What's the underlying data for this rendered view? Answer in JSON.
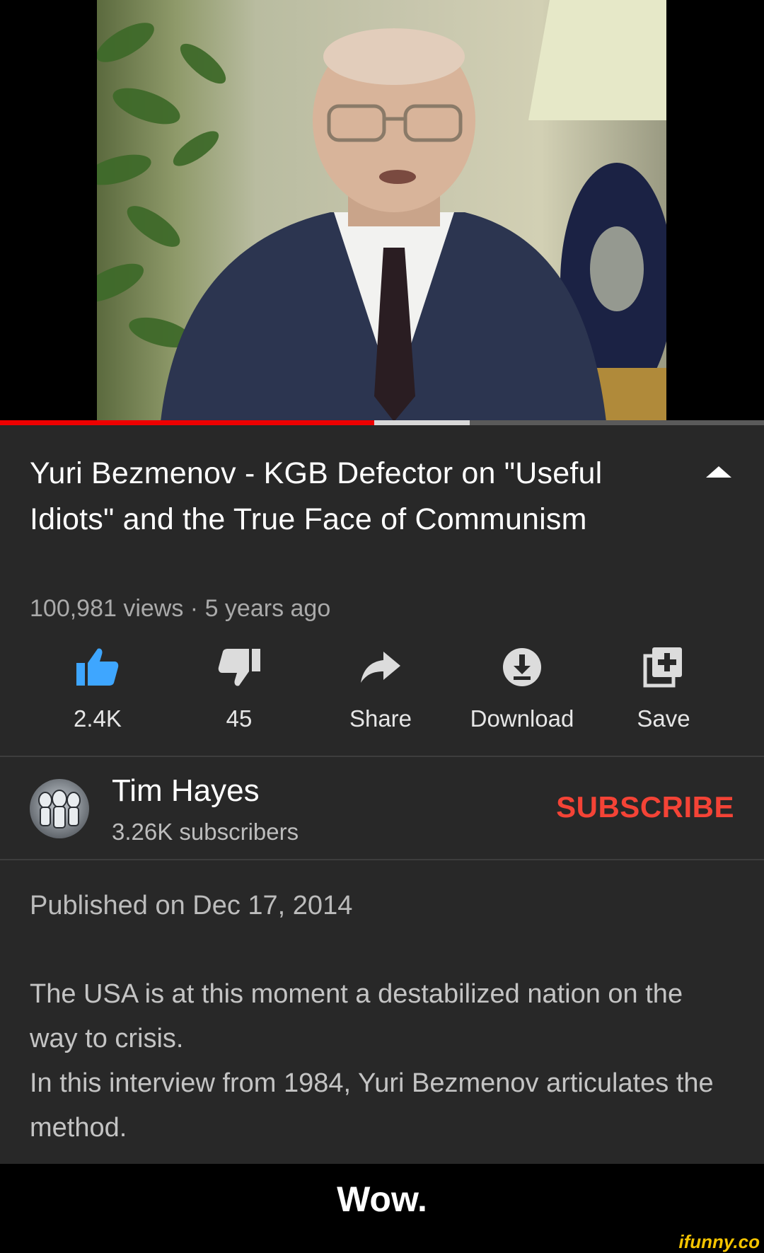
{
  "video": {
    "progress_played": 0.49,
    "progress_buffered": 0.615
  },
  "title": "Yuri Bezmenov - KGB Defector on \"Useful Idiots\" and the True Face of Communism",
  "meta": "100,981 views · 5 years ago",
  "actions": {
    "like_count": "2.4K",
    "dislike_count": "45",
    "share_label": "Share",
    "download_label": "Download",
    "save_label": "Save"
  },
  "channel": {
    "name": "Tim Hayes",
    "subscribers": "3.26K subscribers",
    "subscribe_label": "SUBSCRIBE"
  },
  "published": "Published on Dec 17, 2014",
  "description": {
    "line1": "The USA is at this moment a destabilized nation on the way to crisis.",
    "line2": "In this interview from 1984, Yuri Bezmenov articulates the method."
  },
  "caption": "Wow.",
  "watermark": "ifunny.co",
  "colors": {
    "like_blue": "#3ea6ff",
    "subscribe_red": "#f44336",
    "progress_red": "#ff0000",
    "panel_bg": "#282828"
  },
  "icons": [
    "thumbs-up-icon",
    "thumbs-down-icon",
    "share-arrow-icon",
    "download-icon",
    "add-to-playlist-icon",
    "collapse-caret-icon"
  ]
}
